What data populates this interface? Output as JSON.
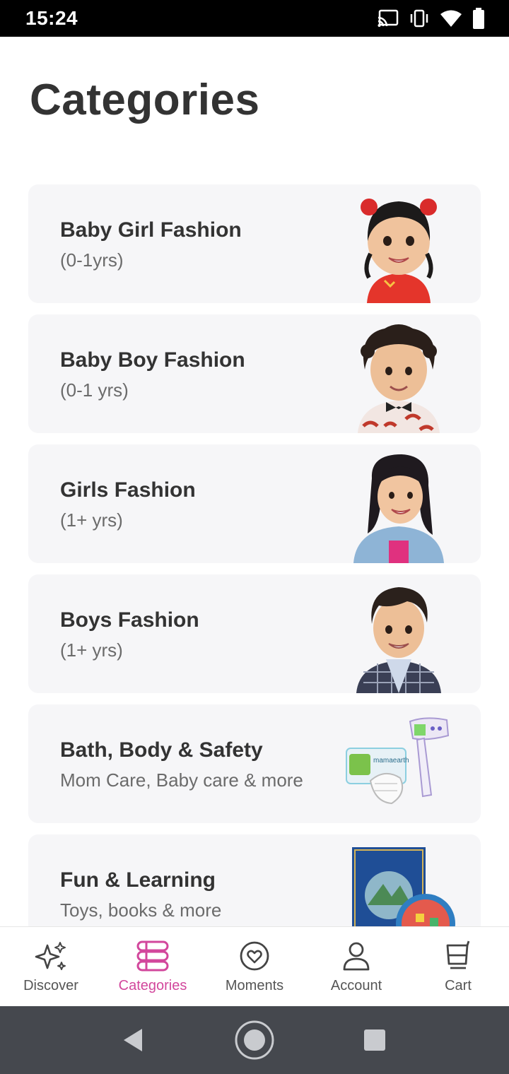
{
  "status": {
    "time": "15:24",
    "icons": [
      "cast-icon",
      "vibrate-icon",
      "wifi-icon",
      "battery-icon"
    ]
  },
  "page": {
    "title": "Categories"
  },
  "categories": [
    {
      "title": "Baby Girl Fashion",
      "subtitle": "(0-1yrs)",
      "image": "baby-girl-photo"
    },
    {
      "title": "Baby Boy Fashion",
      "subtitle": "(0-1 yrs)",
      "image": "baby-boy-photo"
    },
    {
      "title": "Girls Fashion",
      "subtitle": "(1+ yrs)",
      "image": "girl-photo"
    },
    {
      "title": "Boys Fashion",
      "subtitle": "(1+ yrs)",
      "image": "boy-photo"
    },
    {
      "title": "Bath, Body & Safety",
      "subtitle": "Mom Care, Baby care & more",
      "image": "bath-products-photo"
    },
    {
      "title": "Fun & Learning",
      "subtitle": "Toys, books & more",
      "image": "books-toys-photo"
    }
  ],
  "nav": {
    "items": [
      {
        "label": "Discover",
        "icon": "sparkle-icon"
      },
      {
        "label": "Categories",
        "icon": "categories-icon",
        "active": true
      },
      {
        "label": "Moments",
        "icon": "heart-circle-icon"
      },
      {
        "label": "Account",
        "icon": "person-icon"
      },
      {
        "label": "Cart",
        "icon": "cart-icon"
      }
    ]
  },
  "colors": {
    "accent": "#d2479c",
    "card_bg": "#f6f6f8",
    "title_text": "#333333",
    "subtitle_text": "#6b6b6b",
    "system_nav": "#45484e"
  }
}
